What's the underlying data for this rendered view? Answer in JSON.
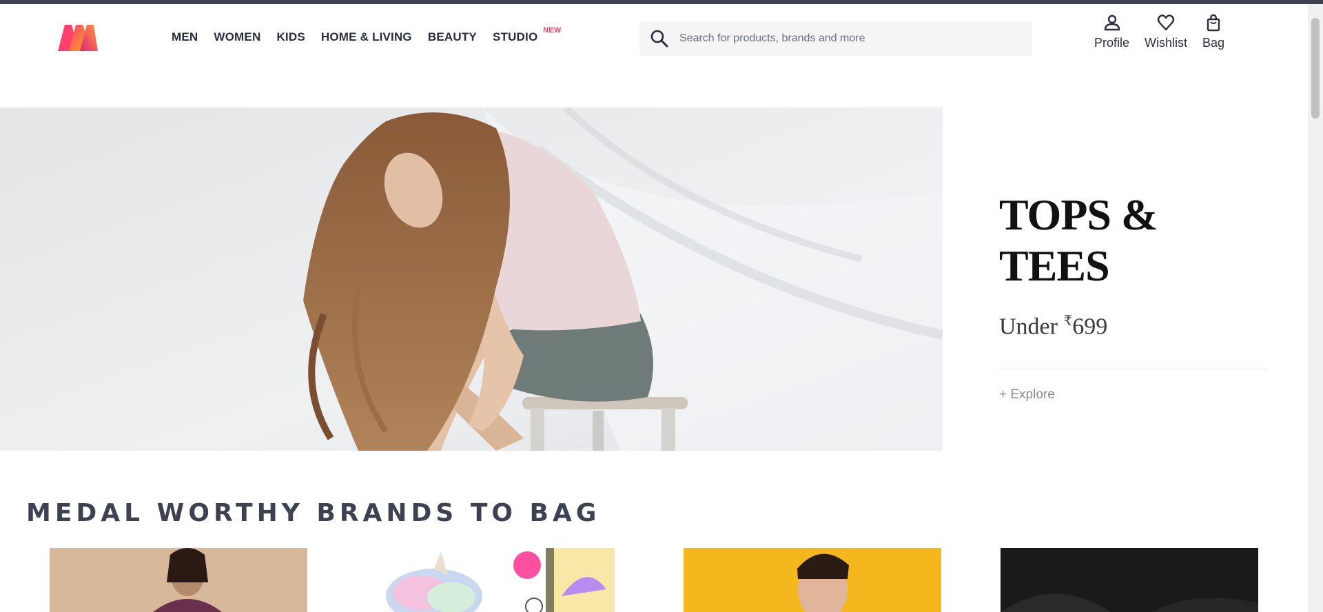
{
  "header": {
    "brand_colors": {
      "pink": "#ff3f6c",
      "orange": "#f26a10",
      "text": "#282c3f"
    },
    "nav": [
      {
        "label": "MEN"
      },
      {
        "label": "WOMEN"
      },
      {
        "label": "KIDS"
      },
      {
        "label": "HOME & LIVING"
      },
      {
        "label": "BEAUTY"
      },
      {
        "label": "STUDIO",
        "badge": "NEW"
      }
    ],
    "search": {
      "placeholder": "Search for products, brands and more",
      "icon": "search-icon"
    },
    "actions": [
      {
        "label": "Profile",
        "icon": "profile-icon"
      },
      {
        "label": "Wishlist",
        "icon": "heart-icon"
      },
      {
        "label": "Bag",
        "icon": "bag-icon"
      }
    ]
  },
  "hero": {
    "title": "TOPS & TEES",
    "subtitle_prefix": "Under ",
    "currency": "₹",
    "price": "699",
    "cta": "+ Explore"
  },
  "section": {
    "title": "MEDAL WORTHY BRANDS TO BAG",
    "cards": [
      {
        "name": "brand-card-1",
        "bg": "#d8b89a"
      },
      {
        "name": "brand-card-2",
        "bg": "#ffffff"
      },
      {
        "name": "brand-card-3",
        "bg": "#f4b81e"
      },
      {
        "name": "brand-card-4",
        "bg": "#1a1a1a"
      }
    ]
  }
}
